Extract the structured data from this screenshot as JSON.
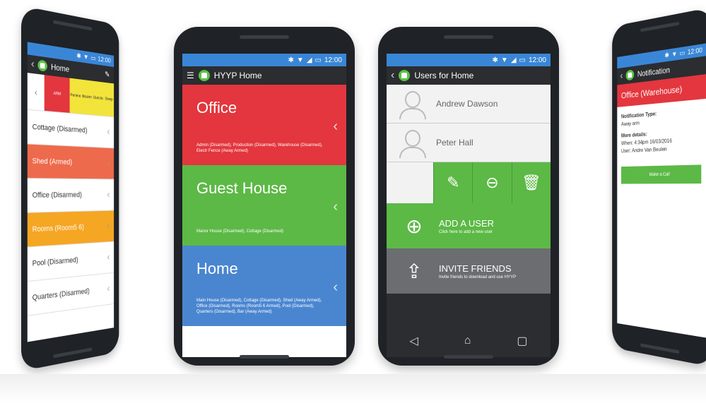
{
  "colors": {
    "red": "#e3363e",
    "green": "#5cb946",
    "blue": "#4a86d0",
    "orange": "#f5a623",
    "salmon": "#ee6a4c",
    "yellow": "#f2e43a",
    "dark": "#2b2d30",
    "status_blue": "#3a86d6"
  },
  "phone1": {
    "status_time": "12:00",
    "title": "Home",
    "zones": [
      "ARM",
      "Perime",
      "Bearm",
      "Gunstc",
      "Sleep"
    ],
    "rows": [
      {
        "label": "Cottage (Disarmed)",
        "color": "#ffffff"
      },
      {
        "label": "Shed (Armed)",
        "color": "#ee6a4c"
      },
      {
        "label": "Office (Disarmed)",
        "color": "#ffffff"
      },
      {
        "label": "Rooms (Room5 6)",
        "color": "#f5a623"
      },
      {
        "label": "Pool (Disarmed)",
        "color": "#ffffff"
      },
      {
        "label": "Quarters (Disarmed)",
        "color": "#ffffff"
      }
    ]
  },
  "phone2": {
    "status_time": "12:00",
    "title": "HYYP Home",
    "cards": [
      {
        "title": "Office",
        "desc": "Admin (Disarmed), Production (Disarmed), Warehouse (Disarmed), Electr Fence (Away Armed)",
        "color": "#e3363e"
      },
      {
        "title": "Guest House",
        "desc": "Manor House (Disarmed), Cottage (Disarmed)",
        "color": "#5cb946"
      },
      {
        "title": "Home",
        "desc": "Main House (Disarmed), Cottage (Disarmed), Shed (Away Armed), Office (Disarmed), Rooms (Room5 6 Armed), Pool (Disarmed), Quarters (Disarmed), Bar (Away Armed)",
        "color": "#4a86d0"
      }
    ]
  },
  "phone3": {
    "status_time": "12:00",
    "title": "Users for Home",
    "users": [
      "Andrew Dawson",
      "Peter Hall"
    ],
    "add_user": {
      "title": "ADD A USER",
      "subtitle": "Click here to add a new user"
    },
    "invite": {
      "title": "INVITE FRIENDS",
      "subtitle": "Invite friends to download and use HYYP"
    }
  },
  "phone4": {
    "status_time": "12:00",
    "title": "Notification",
    "heading": "Office (Warehouse)",
    "type_label": "Notification Type:",
    "type_value": "Away arm",
    "details_label": "More details:",
    "details_when": "When: 4:34pm 16/03/2016",
    "details_user": "User: Andre Van Beulen",
    "call_button": "Make a Call"
  }
}
